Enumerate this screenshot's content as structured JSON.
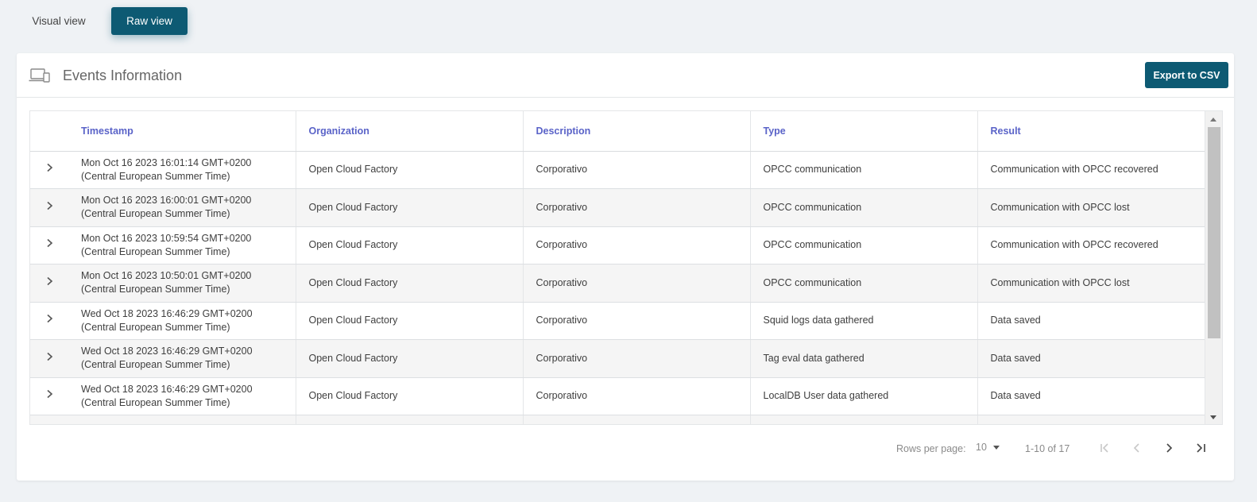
{
  "view_tabs": {
    "visual": "Visual view",
    "raw": "Raw view"
  },
  "card": {
    "title": "Events Information",
    "export_label": "Export to CSV"
  },
  "table": {
    "headers": [
      "Timestamp",
      "Organization",
      "Description",
      "Type",
      "Result"
    ],
    "rows": [
      {
        "ts1": "Mon Oct 16 2023 16:01:14 GMT+0200",
        "ts2": "(Central European Summer Time)",
        "org": "Open Cloud Factory",
        "desc": "Corporativo",
        "type": "OPCC communication",
        "result": "Communication with OPCC recovered"
      },
      {
        "ts1": "Mon Oct 16 2023 16:00:01 GMT+0200",
        "ts2": "(Central European Summer Time)",
        "org": "Open Cloud Factory",
        "desc": "Corporativo",
        "type": "OPCC communication",
        "result": "Communication with OPCC lost"
      },
      {
        "ts1": "Mon Oct 16 2023 10:59:54 GMT+0200",
        "ts2": "(Central European Summer Time)",
        "org": "Open Cloud Factory",
        "desc": "Corporativo",
        "type": "OPCC communication",
        "result": "Communication with OPCC recovered"
      },
      {
        "ts1": "Mon Oct 16 2023 10:50:01 GMT+0200",
        "ts2": "(Central European Summer Time)",
        "org": "Open Cloud Factory",
        "desc": "Corporativo",
        "type": "OPCC communication",
        "result": "Communication with OPCC lost"
      },
      {
        "ts1": "Wed Oct 18 2023 16:46:29 GMT+0200",
        "ts2": "(Central European Summer Time)",
        "org": "Open Cloud Factory",
        "desc": "Corporativo",
        "type": "Squid logs data gathered",
        "result": "Data saved"
      },
      {
        "ts1": "Wed Oct 18 2023 16:46:29 GMT+0200",
        "ts2": "(Central European Summer Time)",
        "org": "Open Cloud Factory",
        "desc": "Corporativo",
        "type": "Tag eval data gathered",
        "result": "Data saved"
      },
      {
        "ts1": "Wed Oct 18 2023 16:46:29 GMT+0200",
        "ts2": "(Central European Summer Time)",
        "org": "Open Cloud Factory",
        "desc": "Corporativo",
        "type": "LocalDB User data gathered",
        "result": "Data saved"
      }
    ]
  },
  "pagination": {
    "rows_per_page_label": "Rows per page:",
    "rows_per_page_value": "10",
    "range_text": "1-10 of 17"
  },
  "icons": {
    "header": "devices-icon",
    "expand": "chevron-right-icon",
    "first": "first-page-icon",
    "prev": "chevron-left-icon",
    "next": "chevron-right-icon",
    "last": "last-page-icon"
  },
  "colors": {
    "accent": "#0d5a73",
    "header_link": "#5a63c8",
    "background": "#eff2f5"
  }
}
